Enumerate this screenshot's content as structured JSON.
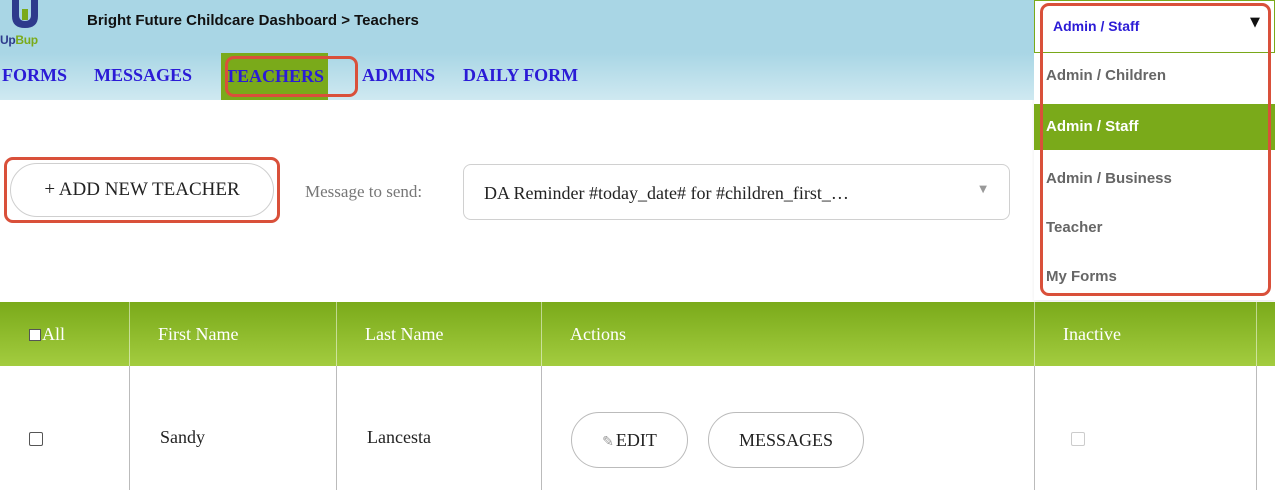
{
  "header": {
    "logo_up": "Up",
    "logo_bup": "Bup",
    "title": "Bright Future Childcare Dashboard > Teachers"
  },
  "role_select": {
    "selected": "Admin / Staff",
    "arrow": "▼",
    "options": [
      "Admin / Children",
      "Admin / Staff",
      "Admin / Business",
      "Teacher",
      "My Forms"
    ]
  },
  "nav": {
    "items": [
      "FORMS",
      "MESSAGES",
      "TEACHERS",
      "ADMINS",
      "DAILY FORM"
    ],
    "active": "TEACHERS"
  },
  "toolbar": {
    "add_label": "+ ADD NEW TEACHER",
    "message_label": "Message to send:",
    "message_value": "DA Reminder #today_date# for #children_first_…",
    "message_arrow": "▼"
  },
  "table": {
    "columns": [
      "All",
      "First Name",
      "Last Name",
      "Actions",
      "Inactive"
    ],
    "rows": [
      {
        "first_name": "Sandy",
        "last_name": "Lancesta",
        "edit_label": "EDIT",
        "messages_label": "MESSAGES"
      }
    ]
  },
  "colors": {
    "accent_green": "#7aaa1a",
    "header_blue": "#a9d6e5",
    "link_blue": "#2b1bd6",
    "highlight_red": "#d9503a"
  }
}
